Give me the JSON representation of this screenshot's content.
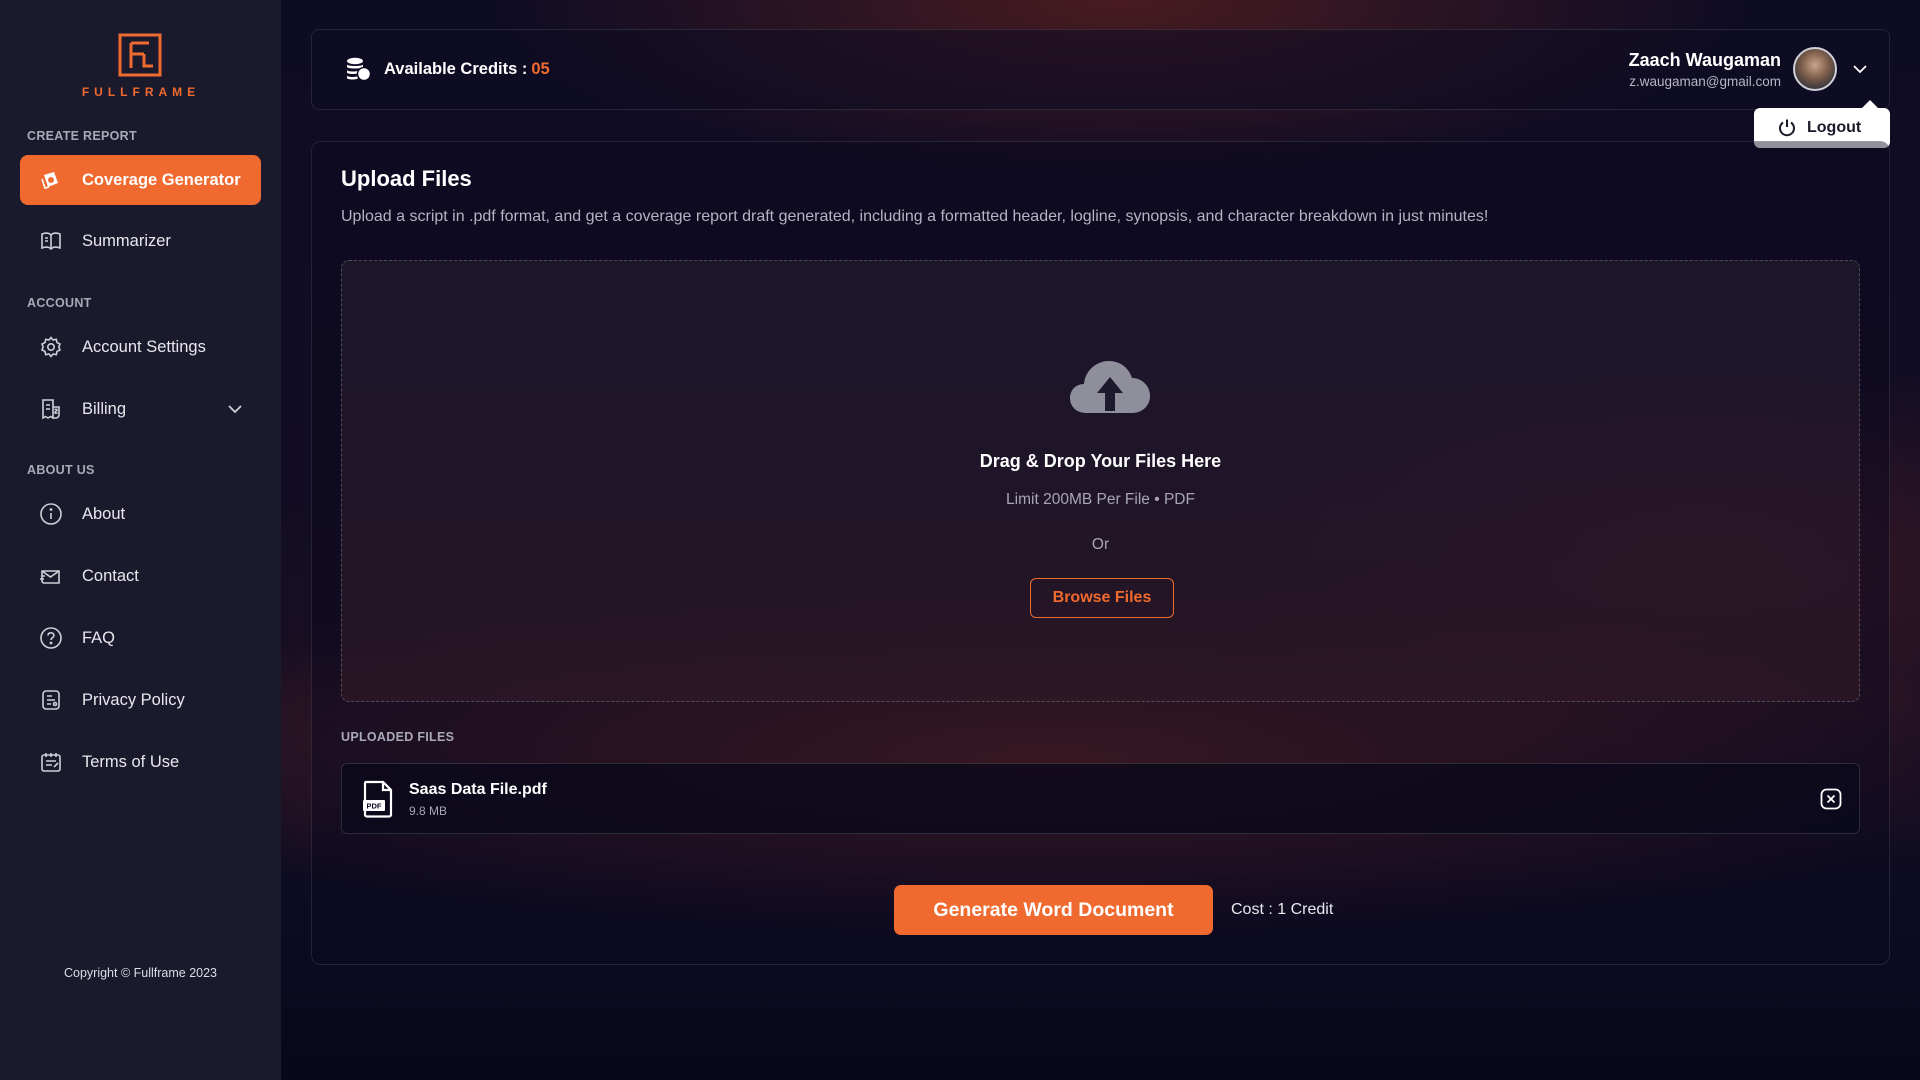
{
  "app": {
    "brand": "FULLFRAME",
    "accent_color": "#f06a2f"
  },
  "sidebar": {
    "sections": [
      {
        "label": "CREATE REPORT"
      },
      {
        "label": "ACCOUNT"
      },
      {
        "label": "ABOUT US"
      }
    ],
    "items": [
      {
        "label": "Coverage Generator",
        "icon": "coverage-icon",
        "active": true
      },
      {
        "label": "Summarizer",
        "icon": "book-icon"
      },
      {
        "label": "Account Settings",
        "icon": "gear-icon"
      },
      {
        "label": "Billing",
        "icon": "billing-icon",
        "expandable": true
      },
      {
        "label": "About",
        "icon": "info-icon"
      },
      {
        "label": "Contact",
        "icon": "mail-icon"
      },
      {
        "label": "FAQ",
        "icon": "question-icon"
      },
      {
        "label": "Privacy Policy",
        "icon": "document-icon"
      },
      {
        "label": "Terms of Use",
        "icon": "terms-icon"
      }
    ],
    "copyright": "Copyright © Fullframe 2023"
  },
  "header": {
    "credits_label": "Available Credits :",
    "credits_value": "05",
    "user_name": "Zaach Waugaman",
    "user_email": "z.waugaman@gmail.com",
    "logout_label": "Logout"
  },
  "main": {
    "title": "Upload Files",
    "description": "Upload a script in .pdf format, and get a coverage report draft generated, including a formatted header, logline, synopsis, and character breakdown in just minutes!",
    "dropzone": {
      "title": "Drag & Drop Your Files Here",
      "limit": "Limit 200MB Per File • PDF",
      "or": "Or",
      "browse_label": "Browse Files"
    },
    "uploaded_label": "UPLOADED FILES",
    "files": [
      {
        "name": "Saas Data File.pdf",
        "size": "9.8 MB",
        "icon": "pdf-file-icon"
      }
    ],
    "generate_label": "Generate Word Document",
    "cost_label": "Cost : 1 Credit"
  }
}
